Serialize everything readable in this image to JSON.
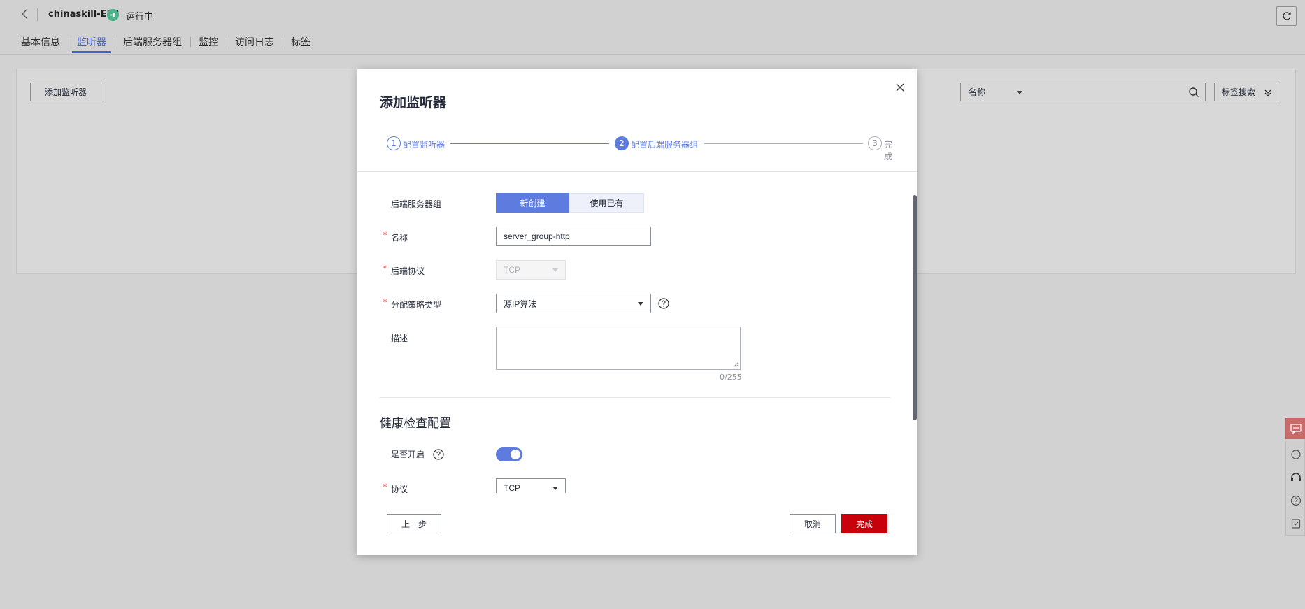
{
  "header": {
    "elb_name": "chinaskill-ELB",
    "status": "运行中",
    "status_color": "#4ab38a",
    "tabs": [
      {
        "label": "基本信息",
        "active": false
      },
      {
        "label": "监听器",
        "active": true
      },
      {
        "label": "后端服务器组",
        "active": false
      },
      {
        "label": "监控",
        "active": false
      },
      {
        "label": "访问日志",
        "active": false
      },
      {
        "label": "标签",
        "active": false
      }
    ]
  },
  "toolbar": {
    "add_listener_label": "添加监听器",
    "search_field_select": "名称",
    "search_value": "",
    "tag_search_label": "标签搜索"
  },
  "dialog": {
    "title": "添加监听器",
    "steps": [
      {
        "number": "1",
        "label": "配置监听器",
        "state": "done"
      },
      {
        "number": "2",
        "label": "配置后端服务器组",
        "state": "active"
      },
      {
        "number": "3",
        "label": "完成",
        "state": "pending"
      }
    ],
    "form": {
      "backend_group_label": "后端服务器组",
      "backend_group_options": [
        "新创建",
        "使用已有"
      ],
      "backend_group_selected": "新创建",
      "name_label": "名称",
      "name_value": "server_group-http",
      "protocol_label": "后端协议",
      "protocol_value": "TCP",
      "strategy_label": "分配策略类型",
      "strategy_value": "源IP算法",
      "description_label": "描述",
      "description_value": "",
      "description_counter": "0/255"
    },
    "health_check": {
      "title": "健康检查配置",
      "enabled_label": "是否开启",
      "enabled": true,
      "protocol_label": "协议",
      "protocol_value": "TCP"
    },
    "buttons": {
      "prev": "上一步",
      "cancel": "取消",
      "finish": "完成"
    }
  },
  "colors": {
    "accent": "#5e7ce0",
    "primary_action": "#c7000b",
    "required_mark": "#e2464b"
  }
}
